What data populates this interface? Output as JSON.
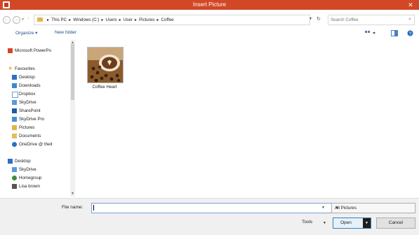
{
  "window": {
    "title": "Insert Picture"
  },
  "address": {
    "breadcrumb": [
      "This PC",
      "Windows (C:)",
      "Users",
      "User",
      "Pictures",
      "Coffee"
    ],
    "search_placeholder": "Search Coffee"
  },
  "toolbar": {
    "organize": "Organize ▾",
    "new_folder": "New folder"
  },
  "nav": {
    "items": [
      {
        "label": "Microsoft PowerPo",
        "icon": "powerpoint-icon"
      },
      {
        "label": "Favourites",
        "icon": "star-icon"
      },
      {
        "label": "Desktop",
        "icon": "desktop-icon"
      },
      {
        "label": "Downloads",
        "icon": "downloads-icon"
      },
      {
        "label": "Dropbox",
        "icon": "dropbox-icon"
      },
      {
        "label": "SkyDrive",
        "icon": "skydrive-icon"
      },
      {
        "label": "SharePoint",
        "icon": "sharepoint-icon"
      },
      {
        "label": "SkyDrive Pro",
        "icon": "skydrive-pro-icon"
      },
      {
        "label": "Pictures",
        "icon": "pictures-icon"
      },
      {
        "label": "Documents",
        "icon": "documents-icon"
      },
      {
        "label": "OneDrive @ theit",
        "icon": "onedrive-icon"
      },
      {
        "label": "Desktop",
        "icon": "desktop-icon"
      },
      {
        "label": "SkyDrive",
        "icon": "skydrive-icon"
      },
      {
        "label": "Homegroup",
        "icon": "homegroup-icon"
      },
      {
        "label": "Lisa brown",
        "icon": "user-icon"
      }
    ]
  },
  "files": [
    {
      "name": "Coffee Heart"
    }
  ],
  "bottom": {
    "file_name_label": "File name:",
    "file_name_value": "",
    "file_type": "All Pictures",
    "tools": "Tools",
    "open": "Open",
    "cancel": "Cancel"
  },
  "colors": {
    "titlebar": "#d24726",
    "accent": "#1f4f8a"
  }
}
